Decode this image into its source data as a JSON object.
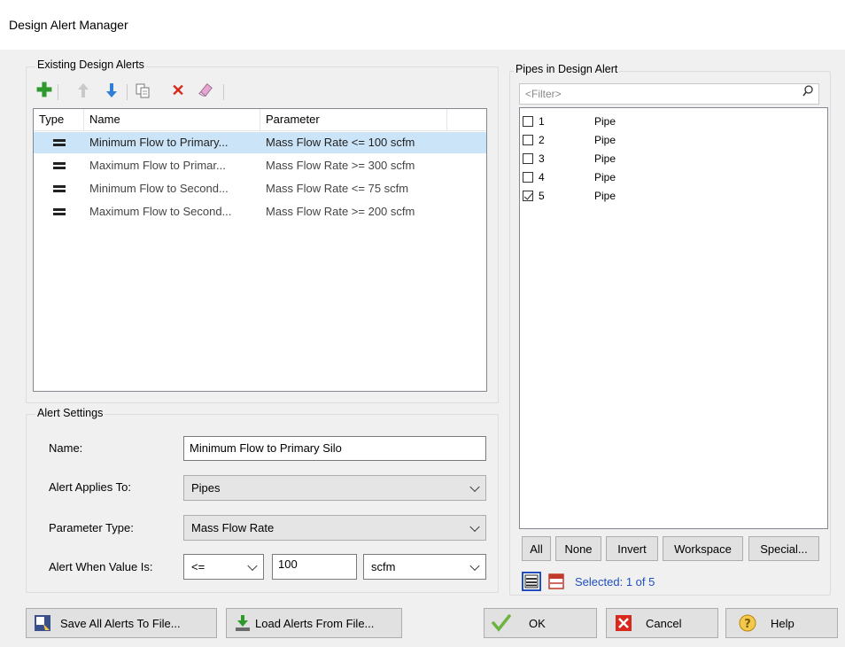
{
  "window": {
    "title": "Design Alert Manager"
  },
  "existing": {
    "group_label": "Existing Design Alerts",
    "columns": {
      "type": "Type",
      "name": "Name",
      "parameter": "Parameter"
    },
    "rows": [
      {
        "name": "Minimum Flow to Primary...",
        "parameter": "Mass Flow Rate <= 100 scfm",
        "selected": true
      },
      {
        "name": "Maximum Flow to Primar...",
        "parameter": "Mass Flow Rate >= 300 scfm",
        "selected": false
      },
      {
        "name": "Minimum Flow to Second...",
        "parameter": "Mass Flow Rate <= 75 scfm",
        "selected": false
      },
      {
        "name": "Maximum Flow to Second...",
        "parameter": "Mass Flow Rate >= 200 scfm",
        "selected": false
      }
    ],
    "icons": {
      "add": "plus-icon",
      "up": "arrow-up-icon",
      "down": "arrow-down-icon",
      "copy": "copy-icon",
      "delete": "delete-x-icon",
      "clear": "eraser-icon"
    }
  },
  "settings": {
    "group_label": "Alert Settings",
    "name_label": "Name:",
    "name_value": "Minimum Flow to Primary Silo",
    "applies_label": "Alert Applies To:",
    "applies_value": "Pipes",
    "param_label": "Parameter Type:",
    "param_value": "Mass Flow Rate",
    "when_label": "Alert When Value Is:",
    "operator_value": "<=",
    "value": "100",
    "unit_value": "scfm"
  },
  "pipes": {
    "group_label": "Pipes in Design Alert",
    "filter_placeholder": "<Filter>",
    "items": [
      {
        "id": "1",
        "type": "Pipe",
        "checked": false
      },
      {
        "id": "2",
        "type": "Pipe",
        "checked": false
      },
      {
        "id": "3",
        "type": "Pipe",
        "checked": false
      },
      {
        "id": "4",
        "type": "Pipe",
        "checked": false
      },
      {
        "id": "5",
        "type": "Pipe",
        "checked": true
      }
    ],
    "buttons": {
      "all": "All",
      "none": "None",
      "invert": "Invert",
      "workspace": "Workspace",
      "special": "Special..."
    },
    "selected_text": "Selected: 1 of 5"
  },
  "footer": {
    "save": "Save All Alerts To File...",
    "load": "Load Alerts From File...",
    "ok": "OK",
    "cancel": "Cancel",
    "help": "Help"
  },
  "colors": {
    "selection": "#cce4f7",
    "add_green": "#2e9a2e",
    "arrow_blue": "#2f7fd8",
    "delete_red": "#d9281c",
    "status_blue": "#1f4fbf"
  }
}
